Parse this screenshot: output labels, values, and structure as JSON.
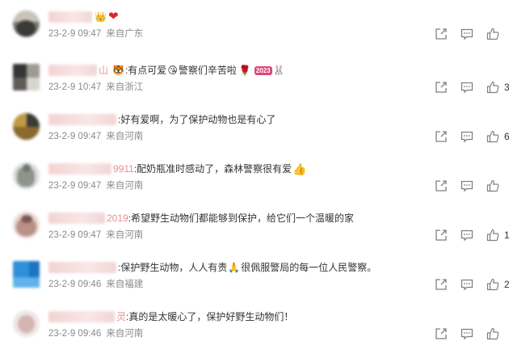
{
  "comments": [
    {
      "user_blur": "",
      "text": "",
      "emoji_before": "",
      "emoji_after": "❤",
      "date": "23-2-9 09:47",
      "source": "来自广东",
      "likes": ""
    },
    {
      "user_blur": "山",
      "text": ":有点可爱",
      "emoji_before": "🐯",
      "emoji_after": "😘",
      "text2": "警察们辛苦啦",
      "emoji_tail": "🌹",
      "badge": "2023",
      "date": "23-2-9 10:47",
      "source": "来自浙江",
      "likes": "3"
    },
    {
      "user_blur": "",
      "text": ":好有爱啊，为了保护动物也是有心了",
      "date": "23-2-9 09:47",
      "source": "来自河南",
      "likes": "6"
    },
    {
      "user_blur": "9911",
      "text": ":配奶瓶准时感动了，森林警察很有爱",
      "emoji_after": "👍",
      "date": "23-2-9 09:47",
      "source": "来自河南",
      "likes": ""
    },
    {
      "user_blur": "2019",
      "text": ":希望野生动物们都能够到保护，给它们一个温暖的家",
      "date": "23-2-9 09:47",
      "source": "来自河南",
      "likes": "1"
    },
    {
      "user_blur": "",
      "text": ":保护野生动物，人人有责",
      "emoji_after": "🙏",
      "text2": "很佩服警局的每一位人民警察。",
      "date": "23-2-9 09:46",
      "source": "来自福建",
      "likes": "2"
    },
    {
      "user_blur": "灵",
      "text": ":真的是太暖心了，保护好野生动物们！",
      "date": "23-2-9 09:46",
      "source": "来自河南",
      "likes": ""
    }
  ],
  "icons": {
    "share": "share-icon",
    "reply": "comment-icon",
    "like": "thumbs-up-icon"
  },
  "colors": {
    "text": "#333333",
    "meta": "#8a8a8a",
    "icon": "#808080"
  }
}
